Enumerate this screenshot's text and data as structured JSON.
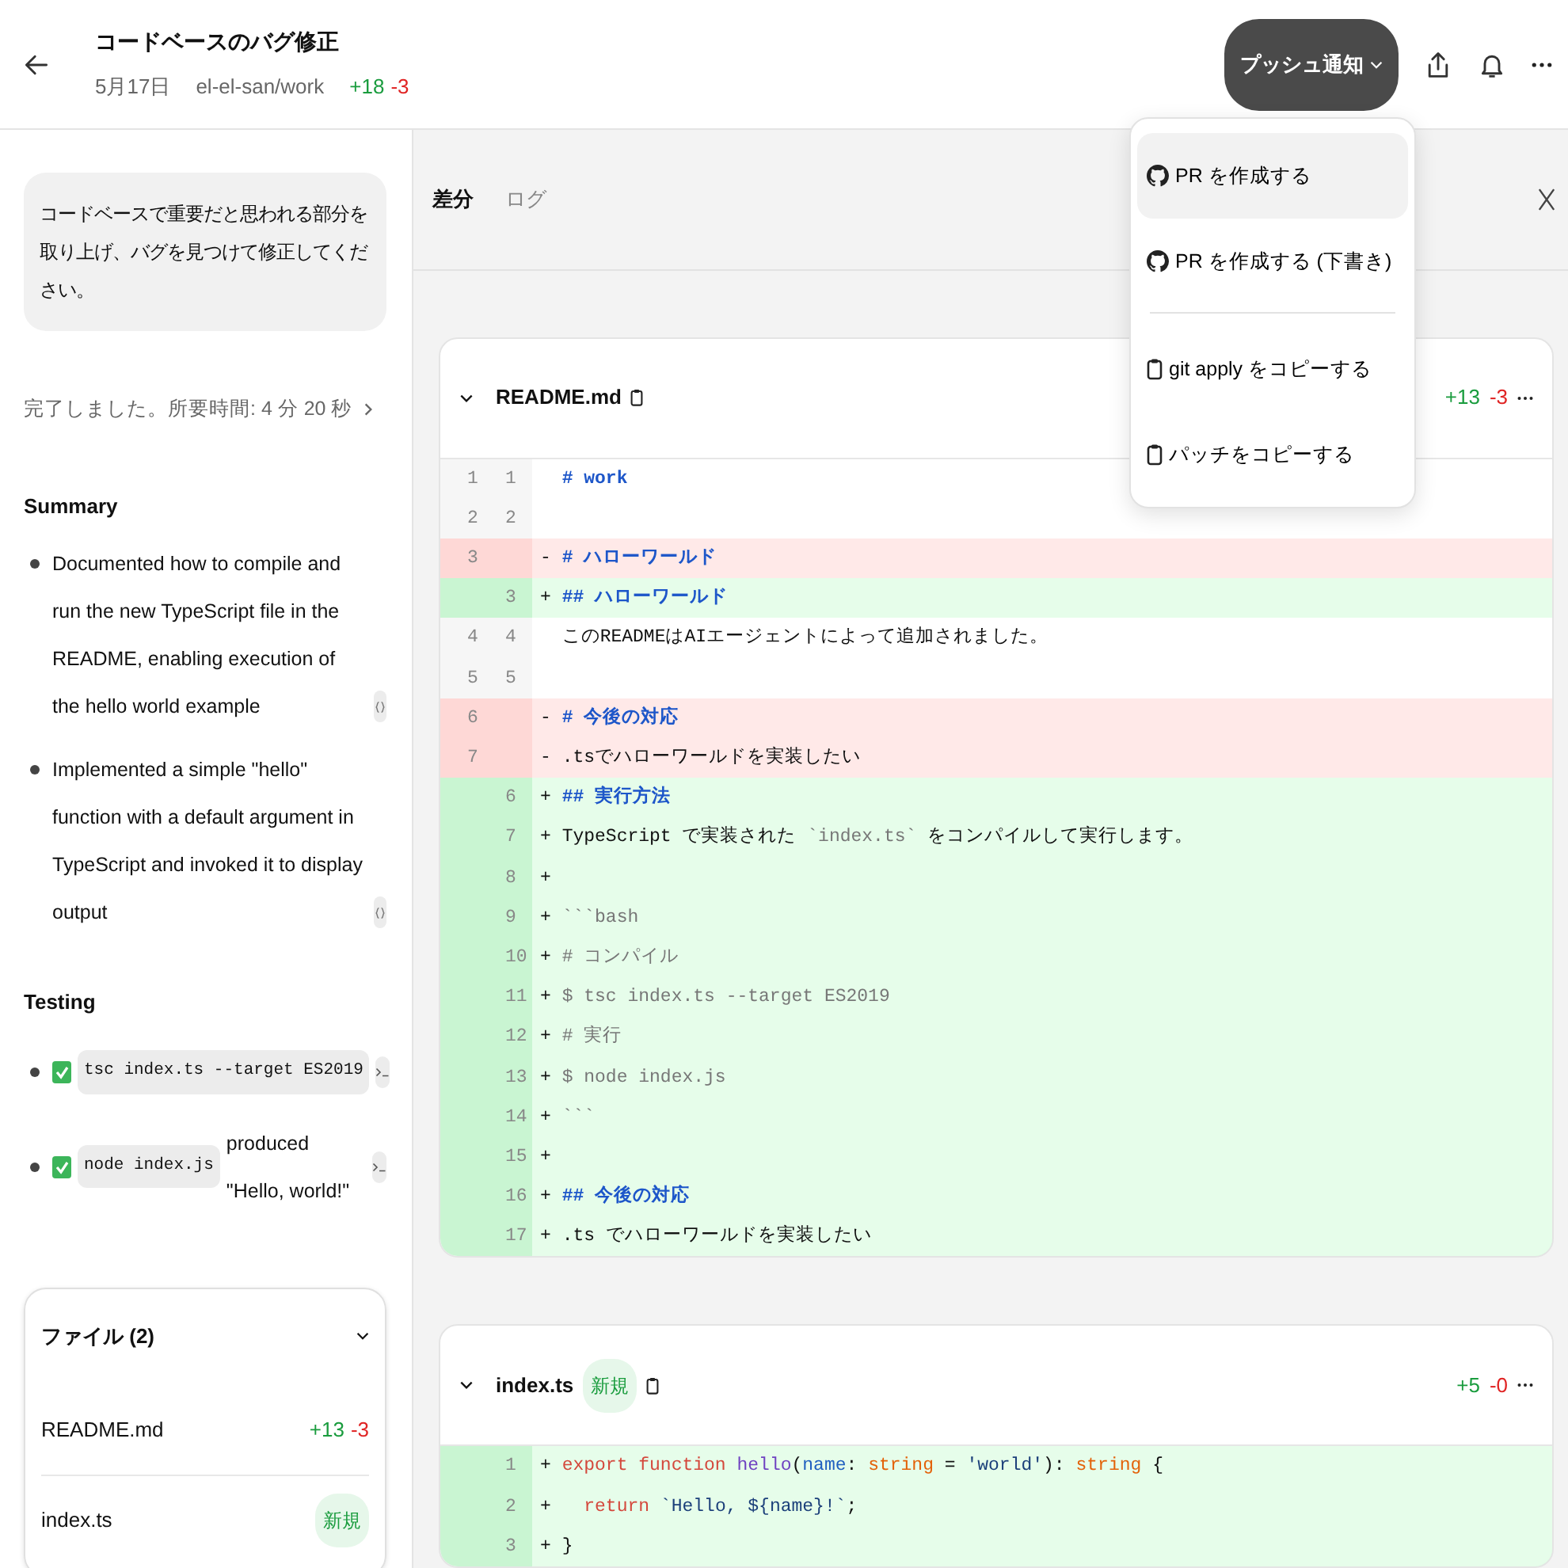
{
  "header": {
    "title": "コードベースのバグ修正",
    "date": "5月17日",
    "repo": "el-el-san/work",
    "additions": "+18",
    "deletions": "-3",
    "push_button": "プッシュ通知"
  },
  "sidebar": {
    "prompt": "コードベースで重要だと思われる部分を取り上げ、バグを見つけて修正してください。",
    "status": "完了しました。所要時間: 4 分 20 秒",
    "summary": {
      "heading": "Summary",
      "items": [
        {
          "text": "Documented how to compile and run the new TypeScript file in the README, enabling execution of the hello world example"
        },
        {
          "text": "Implemented a simple \"hello\" function with a default argument in TypeScript and invoked it to display output"
        }
      ]
    },
    "testing": {
      "heading": "Testing",
      "items": [
        {
          "checked": true,
          "command": "tsc index.ts --target ES2019"
        },
        {
          "checked": true,
          "command": "node index.js",
          "note": "produced \"Hello, world!\""
        }
      ]
    },
    "files": {
      "title": "ファイル (2)",
      "expanded": true,
      "items": [
        {
          "name": "README.md",
          "additions": "+13",
          "deletions": "-3"
        },
        {
          "name": "index.ts",
          "badge": "新規"
        }
      ]
    }
  },
  "diff_panel": {
    "tabs": [
      {
        "label": "差分",
        "selected": true
      },
      {
        "label": "ログ",
        "selected": false
      }
    ],
    "files": [
      {
        "name": "README.md",
        "additions": "+13",
        "deletions": "-3",
        "expanded": true,
        "lines": [
          {
            "old": "1",
            "new": "1",
            "kind": "context",
            "segments": [
              {
                "kind": "heading",
                "text": "# work"
              }
            ]
          },
          {
            "old": "2",
            "new": "2",
            "kind": "context"
          },
          {
            "old": "3",
            "kind": "del",
            "sign": "-",
            "segments": [
              {
                "kind": "heading",
                "text": "# ハローワールド"
              }
            ]
          },
          {
            "new": "3",
            "kind": "add",
            "sign": "+",
            "segments": [
              {
                "kind": "heading",
                "text": "## ハローワールド"
              }
            ]
          },
          {
            "old": "4",
            "new": "4",
            "kind": "context",
            "segments": [
              {
                "kind": "plain",
                "text": "このREADMEはAIエージェントによって追加されました。"
              }
            ]
          },
          {
            "old": "5",
            "new": "5",
            "kind": "context"
          },
          {
            "old": "6",
            "kind": "del",
            "sign": "-",
            "segments": [
              {
                "kind": "heading",
                "text": "# 今後の対応"
              }
            ]
          },
          {
            "old": "7",
            "kind": "del",
            "sign": "-",
            "segments": [
              {
                "kind": "plain",
                "text": ".tsでハローワールドを実装したい"
              }
            ]
          },
          {
            "new": "6",
            "kind": "add",
            "sign": "+",
            "segments": [
              {
                "kind": "heading",
                "text": "## 実行方法"
              }
            ]
          },
          {
            "new": "7",
            "kind": "add",
            "sign": "+",
            "segments": [
              {
                "kind": "plain",
                "text": "TypeScript で実装された "
              },
              {
                "kind": "code",
                "text": "`index.ts`"
              },
              {
                "kind": "plain",
                "text": " をコンパイルして実行します。"
              }
            ]
          },
          {
            "new": "8",
            "kind": "add",
            "sign": "+"
          },
          {
            "new": "9",
            "kind": "add",
            "sign": "+",
            "segments": [
              {
                "kind": "code",
                "text": "```bash"
              }
            ]
          },
          {
            "new": "10",
            "kind": "add",
            "sign": "+",
            "segments": [
              {
                "kind": "code",
                "text": "# コンパイル"
              }
            ]
          },
          {
            "new": "11",
            "kind": "add",
            "sign": "+",
            "segments": [
              {
                "kind": "code",
                "text": "$ tsc index.ts --target ES2019"
              }
            ]
          },
          {
            "new": "12",
            "kind": "add",
            "sign": "+",
            "segments": [
              {
                "kind": "code",
                "text": "# 実行"
              }
            ]
          },
          {
            "new": "13",
            "kind": "add",
            "sign": "+",
            "segments": [
              {
                "kind": "code",
                "text": "$ node index.js"
              }
            ]
          },
          {
            "new": "14",
            "kind": "add",
            "sign": "+",
            "segments": [
              {
                "kind": "code",
                "text": "```"
              }
            ]
          },
          {
            "new": "15",
            "kind": "add",
            "sign": "+"
          },
          {
            "new": "16",
            "kind": "add",
            "sign": "+",
            "segments": [
              {
                "kind": "heading",
                "text": "## 今後の対応"
              }
            ]
          },
          {
            "new": "17",
            "kind": "add",
            "sign": "+",
            "segments": [
              {
                "kind": "plain",
                "text": ".ts でハローワールドを実装したい"
              }
            ]
          }
        ]
      },
      {
        "name": "index.ts",
        "badge": "新規",
        "additions": "+5",
        "deletions": "-0",
        "expanded": true,
        "lines": [
          {
            "new": "1",
            "kind": "add",
            "sign": "+",
            "segments": [
              {
                "kind": "keyword",
                "text": "export function "
              },
              {
                "kind": "function",
                "text": "hello"
              },
              {
                "kind": "plain",
                "text": "("
              },
              {
                "kind": "param",
                "text": "name"
              },
              {
                "kind": "plain",
                "text": ": "
              },
              {
                "kind": "type",
                "text": "string"
              },
              {
                "kind": "plain",
                "text": " = "
              },
              {
                "kind": "string",
                "text": "'world'"
              },
              {
                "kind": "plain",
                "text": "): "
              },
              {
                "kind": "type",
                "text": "string"
              },
              {
                "kind": "plain",
                "text": " {"
              }
            ]
          },
          {
            "new": "2",
            "kind": "add",
            "sign": "+",
            "segments": [
              {
                "kind": "keyword",
                "text": "  return"
              },
              {
                "kind": "string",
                "text": " `Hello, ${name}!`"
              },
              {
                "kind": "plain",
                "text": ";"
              }
            ]
          },
          {
            "new": "3",
            "kind": "add",
            "sign": "+",
            "segments": [
              {
                "kind": "plain",
                "text": "}"
              }
            ]
          }
        ]
      }
    ]
  },
  "menu": {
    "items": [
      {
        "kind": "github",
        "label": "PR を作成する",
        "selected": true,
        "separator_before": false
      },
      {
        "kind": "github",
        "label": "PR を作成する (下書き)",
        "selected": false,
        "separator_before": false
      },
      {
        "kind": "clipboard",
        "label": "git apply をコピーする",
        "selected": false,
        "separator_before": true
      },
      {
        "kind": "clipboard",
        "label": "パッチをコピーする",
        "selected": false,
        "separator_before": false
      }
    ]
  }
}
